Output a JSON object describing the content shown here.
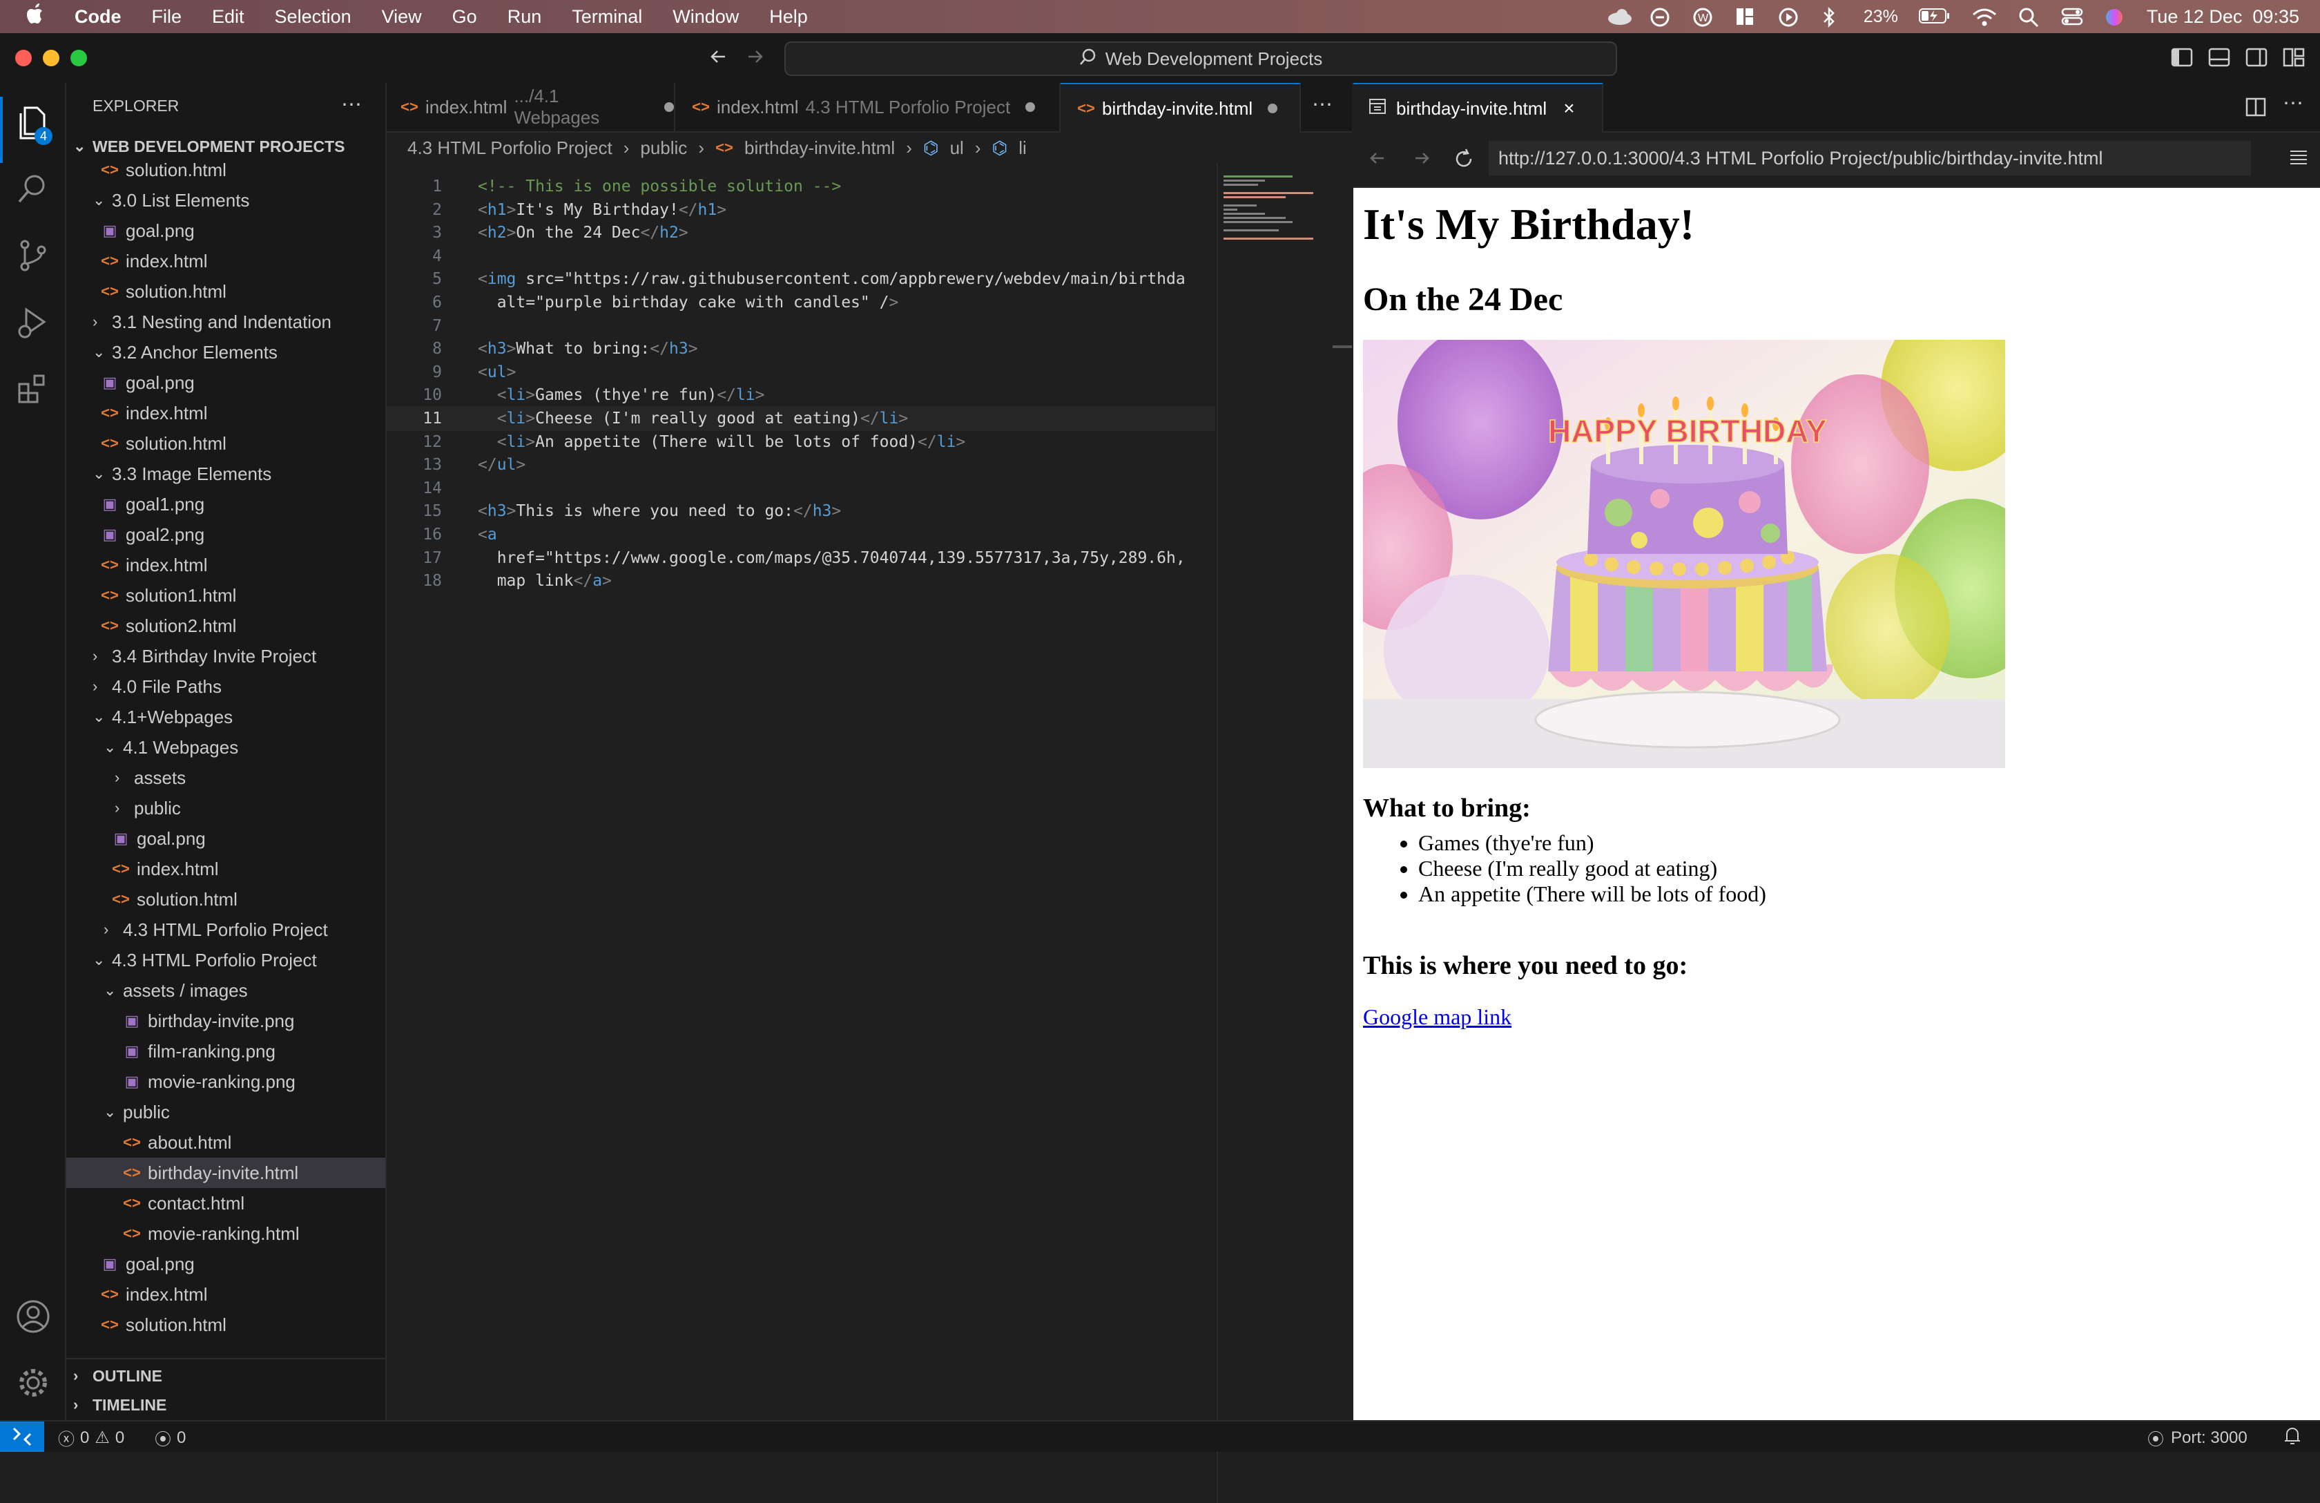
{
  "menubar": {
    "app": "Code",
    "items": [
      "File",
      "Edit",
      "Selection",
      "View",
      "Go",
      "Run",
      "Terminal",
      "Window",
      "Help"
    ],
    "battery": "23%",
    "datetime": "Tue 12 Dec  09:35"
  },
  "titlebar": {
    "search": "Web Development Projects"
  },
  "activity": {
    "explorer_badge": "4"
  },
  "sidebar": {
    "title": "EXPLORER",
    "project": "WEB DEVELOPMENT PROJECTS",
    "outline": "OUTLINE",
    "timeline": "TIMELINE",
    "items": [
      {
        "label": "solution.html",
        "kind": "html"
      },
      {
        "label": "3.0 List Elements",
        "kind": "folder-open"
      },
      {
        "label": "goal.png",
        "kind": "png"
      },
      {
        "label": "index.html",
        "kind": "html"
      },
      {
        "label": "solution.html",
        "kind": "html"
      },
      {
        "label": "3.1 Nesting and Indentation",
        "kind": "folder"
      },
      {
        "label": "3.2 Anchor Elements",
        "kind": "folder-open"
      },
      {
        "label": "goal.png",
        "kind": "png"
      },
      {
        "label": "index.html",
        "kind": "html"
      },
      {
        "label": "solution.html",
        "kind": "html"
      },
      {
        "label": "3.3 Image Elements",
        "kind": "folder-open"
      },
      {
        "label": "goal1.png",
        "kind": "png"
      },
      {
        "label": "goal2.png",
        "kind": "png"
      },
      {
        "label": "index.html",
        "kind": "html"
      },
      {
        "label": "solution1.html",
        "kind": "html"
      },
      {
        "label": "solution2.html",
        "kind": "html"
      },
      {
        "label": "3.4 Birthday Invite Project",
        "kind": "folder"
      },
      {
        "label": "4.0 File Paths",
        "kind": "folder"
      },
      {
        "label": "4.1+Webpages",
        "kind": "folder-open"
      },
      {
        "label": "4.1 Webpages",
        "kind": "folder-open"
      },
      {
        "label": "assets",
        "kind": "folder"
      },
      {
        "label": "public",
        "kind": "folder"
      },
      {
        "label": "goal.png",
        "kind": "png"
      },
      {
        "label": "index.html",
        "kind": "html"
      },
      {
        "label": "solution.html",
        "kind": "html"
      },
      {
        "label": "4.3 HTML Porfolio Project",
        "kind": "folder"
      },
      {
        "label": "4.3 HTML Porfolio Project",
        "kind": "folder-open"
      },
      {
        "label": "assets / images",
        "kind": "folder-open"
      },
      {
        "label": "birthday-invite.png",
        "kind": "png"
      },
      {
        "label": "film-ranking.png",
        "kind": "png"
      },
      {
        "label": "movie-ranking.png",
        "kind": "png"
      },
      {
        "label": "public",
        "kind": "folder-open"
      },
      {
        "label": "about.html",
        "kind": "html"
      },
      {
        "label": "birthday-invite.html",
        "kind": "html"
      },
      {
        "label": "contact.html",
        "kind": "html"
      },
      {
        "label": "movie-ranking.html",
        "kind": "html"
      },
      {
        "label": "goal.png",
        "kind": "png"
      },
      {
        "label": "index.html",
        "kind": "html"
      },
      {
        "label": "solution.html",
        "kind": "html"
      }
    ]
  },
  "editor": {
    "tabs": [
      {
        "label": "index.html",
        "sub": ".../4.1 Webpages"
      },
      {
        "label": "index.html",
        "sub": "4.3 HTML Porfolio Project"
      },
      {
        "label": "birthday-invite.html",
        "sub": ""
      }
    ],
    "breadcrumb": [
      "4.3 HTML Porfolio Project",
      "public",
      "birthday-invite.html",
      "ul",
      "li"
    ],
    "lines": [
      "<!-- This is one possible solution -->",
      "<h1>It's My Birthday!</h1>",
      "<h2>On the 24 Dec</h2>",
      "",
      "<img src=\"https://raw.githubusercontent.com/appbrewery/webdev/main/birthda",
      "  alt=\"purple birthday cake with candles\" />",
      "",
      "<h3>What to bring:</h3>",
      "<ul>",
      "  <li>Games (thye're fun)</li>",
      "  <li>Cheese (I'm really good at eating)</li>",
      "  <li>An appetite (There will be lots of food)</li>",
      "</ul>",
      "",
      "<h3>This is where you need to go:</h3>",
      "<a",
      "  href=\"https://www.google.com/maps/@35.7040744,139.5577317,3a,75y,289.6h,",
      "  map link</a>"
    ]
  },
  "preview": {
    "tab": "birthday-invite.html",
    "url": "http://127.0.0.1:3000/4.3 HTML Porfolio Project/public/birthday-invite.html",
    "h1": "It's My Birthday!",
    "h2": "On the 24 Dec",
    "h3a": "What to bring:",
    "items": [
      "Games (thye're fun)",
      "Cheese (I'm really good at eating)",
      "An appetite (There will be lots of food)"
    ],
    "h3b": "This is where you need to go:",
    "link": "Google map link",
    "cake_letters": "HAPPY BIRTHDAY"
  },
  "statusbar": {
    "errors": "0",
    "warnings": "0",
    "ports": "0",
    "port": "Port: 3000"
  }
}
